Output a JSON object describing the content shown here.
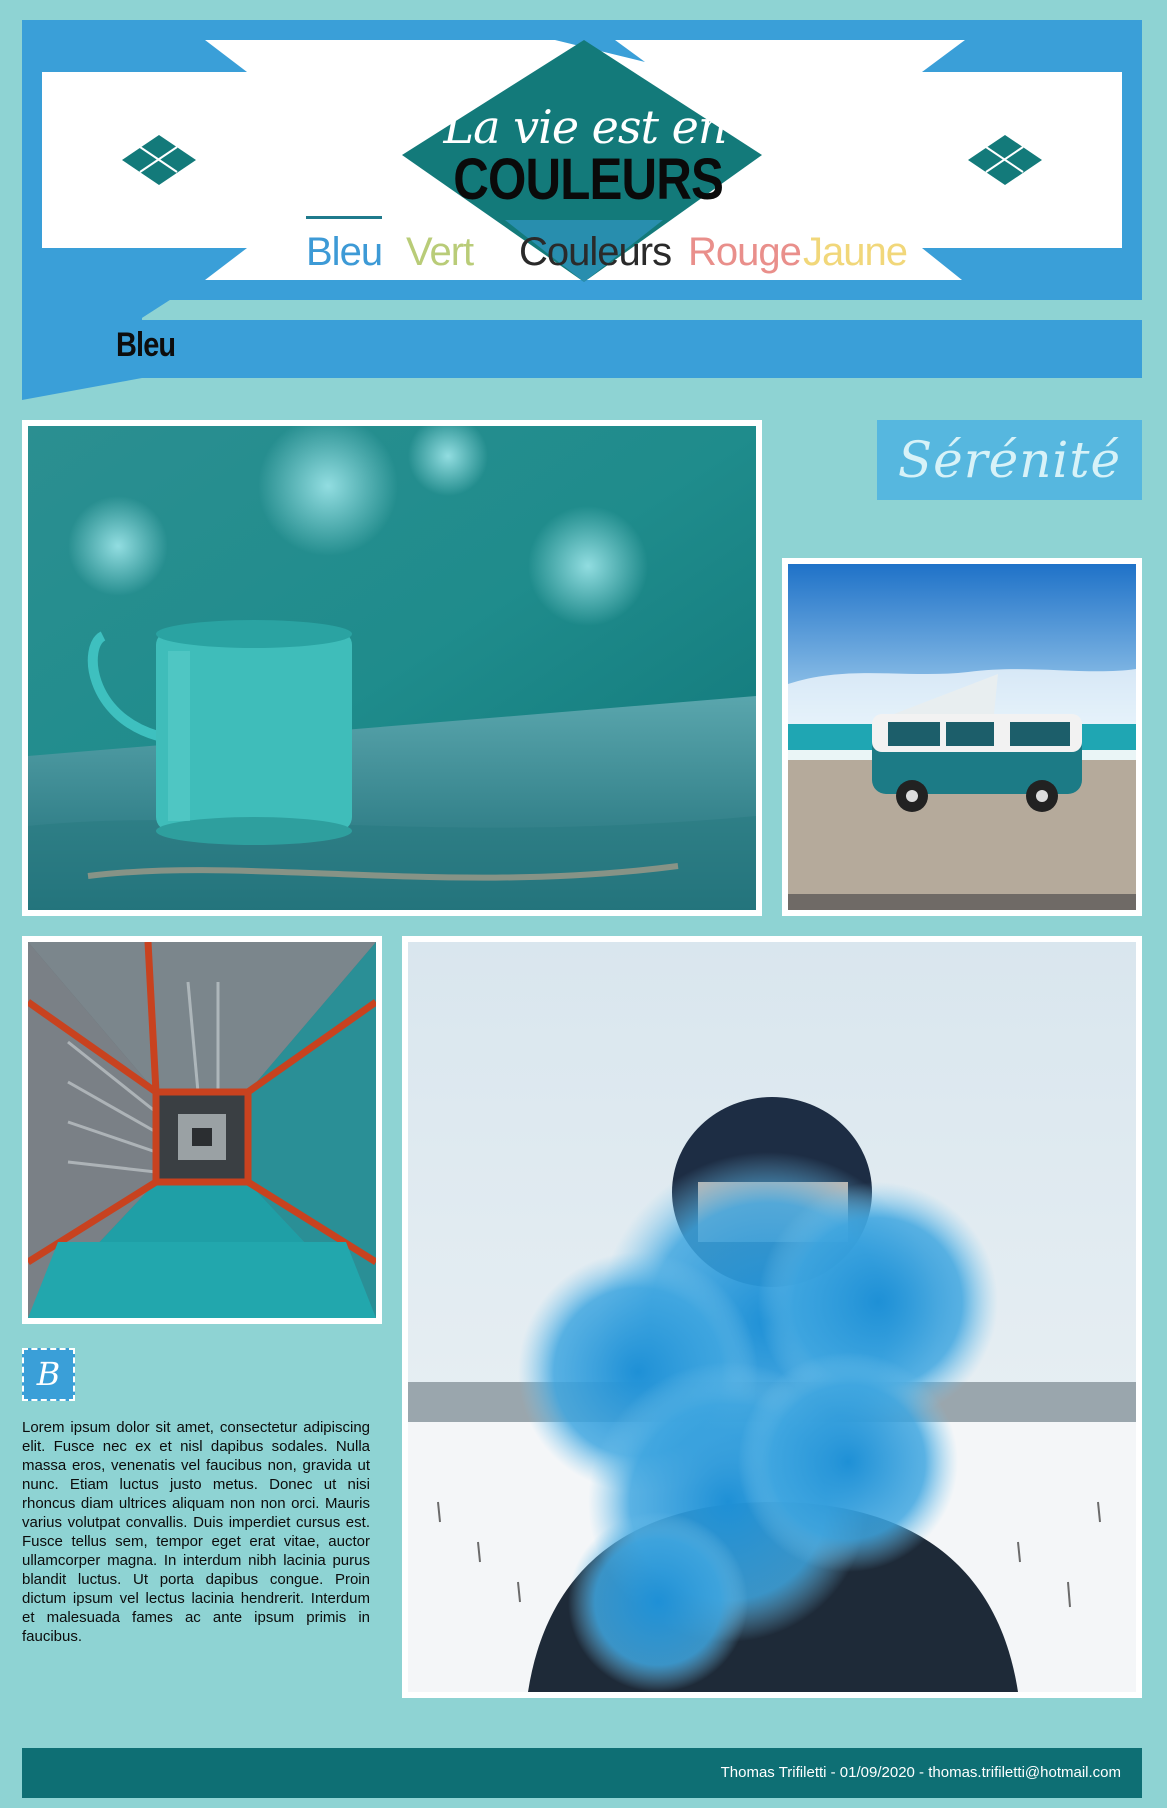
{
  "header": {
    "title_script": "La vie est en",
    "title_main": "COULEURS",
    "nav": [
      {
        "label": "Bleu",
        "color": "#3d9ad6",
        "active": true
      },
      {
        "label": "Vert",
        "color": "#b9cc78",
        "active": false
      },
      {
        "label": "Couleurs",
        "color": "#2a2a2a",
        "active": false
      },
      {
        "label": "Rouge",
        "color": "#e98f8b",
        "active": false
      },
      {
        "label": "Jaune",
        "color": "#f1d77a",
        "active": false
      }
    ]
  },
  "section": {
    "title": "Bleu"
  },
  "aside": {
    "tag": "Sérénité"
  },
  "article": {
    "badge_letter": "B",
    "body": "Lorem ipsum dolor sit amet, consectetur adipiscing elit. Fusce nec ex et nisl dapibus sodales. Nulla massa eros, venenatis vel faucibus non, gravida ut nunc. Etiam luctus justo metus. Donec ut nisi rhoncus diam ultrices aliquam non non orci. Mauris varius volutpat convallis. Duis imperdiet cursus est. Fusce tellus sem, tempor eget erat vitae, auctor ullamcorper magna. In interdum nibh lacinia purus blandit luctus. Ut porta dapibus congue. Proin dictum ipsum vel lectus lacinia hendrerit. Interdum et malesuada fames ac ante ipsum primis in faucibus."
  },
  "footer": {
    "text": "Thomas Trifiletti - 01/09/2020 - thomas.trifiletti@hotmail.com"
  },
  "colors": {
    "page_bg": "#8ed3d3",
    "banner_blue": "#3a9fd8",
    "teal": "#137a7a",
    "footer_bg": "#0e6f74"
  },
  "icons": [
    "diamond-ornament-icon"
  ]
}
